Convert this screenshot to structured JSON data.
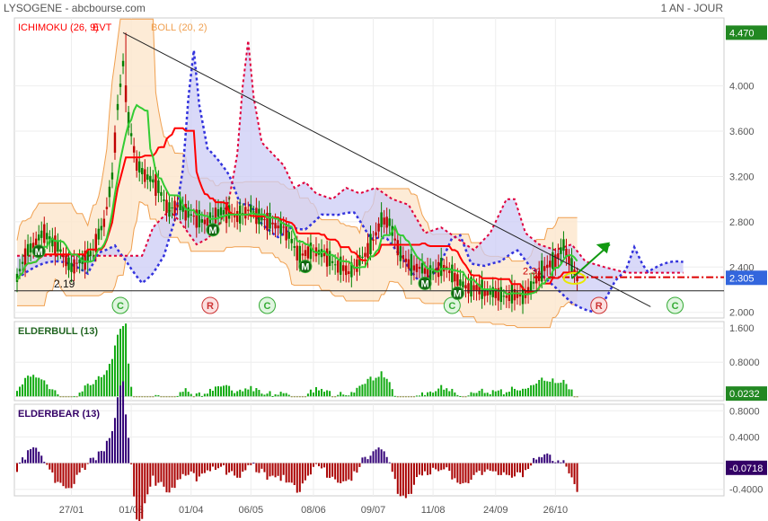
{
  "header": {
    "title": "LYSOGENE - abcbourse.com",
    "period": "1 AN - JOUR"
  },
  "colors": {
    "price_up": "#008000",
    "price_down": "#c00000",
    "ichimoku_line": "#ff0000",
    "kijun_green": "#33cc33",
    "cloud_fill": "#ccccf5",
    "cloud_border_red": "#e0003c",
    "cloud_border_blue": "#3333dd",
    "bollinger": "#f0a050",
    "bollinger_fill": "#fde6cc",
    "trendline": "#222222",
    "support": "#222222",
    "target_arrow": "#119911",
    "circle_highlight": "#e8e800",
    "price_tag": "#3366dd",
    "max_tag": "#228822",
    "bull_bar": "#11aa11",
    "bear_bar_pos": "#330077",
    "bear_bar_neg": "#aa0000",
    "bear_tag": "#330066"
  },
  "chart_data": [
    {
      "type": "candlestick",
      "indicators_legend": [
        "ICHIMOKU (26, 9)",
        "EVT",
        "BOLL (20, 2)"
      ],
      "ylim": [
        1.95,
        4.6
      ],
      "yticks": [
        4.0,
        3.6,
        3.2,
        2.8,
        2.4,
        2.0
      ],
      "ytick_labels": [
        "4.000",
        "3.600",
        "3.200",
        "2.800",
        "2.400",
        "2.000"
      ],
      "max_label": "4.470",
      "last_price": 2.305,
      "last_price_label": "2.305",
      "support_level": 2.19,
      "support_label": "2.19",
      "annotated_level": 2.31,
      "annotated_label": "2.31",
      "signals": [
        {
          "kind": "M",
          "i": 8
        },
        {
          "kind": "C",
          "i": 38
        },
        {
          "kind": "M",
          "i": 72
        },
        {
          "kind": "R",
          "i": 71
        },
        {
          "kind": "C",
          "i": 92
        },
        {
          "kind": "M",
          "i": 106
        },
        {
          "kind": "M",
          "i": 150
        },
        {
          "kind": "C",
          "i": 160
        },
        {
          "kind": "M",
          "i": 162
        },
        {
          "kind": "R",
          "i": 214
        },
        {
          "kind": "C",
          "i": 242
        }
      ]
    },
    {
      "type": "bar",
      "series_name": "ELDERBULL (13)",
      "ylim": [
        -0.1,
        1.75
      ],
      "yticks": [
        1.6,
        0.8
      ],
      "ytick_labels": [
        "1.600",
        "0.8000"
      ],
      "last_value_label": "0.0232"
    },
    {
      "type": "bar",
      "series_name": "ELDERBEAR (13)",
      "ylim": [
        -0.5,
        0.9
      ],
      "yticks": [
        0.8,
        0.4,
        -0.4
      ],
      "ytick_labels": [
        "0.8000",
        "0.4000",
        "-0.4000"
      ],
      "last_value_label": "-0.0718"
    }
  ],
  "x_axis": {
    "labels": [
      "27/01",
      "01/03",
      "01/04",
      "06/05",
      "08/06",
      "09/07",
      "11/08",
      "24/09",
      "26/10"
    ],
    "label_index": [
      20,
      42,
      64,
      86,
      109,
      131,
      153,
      176,
      198
    ]
  }
}
